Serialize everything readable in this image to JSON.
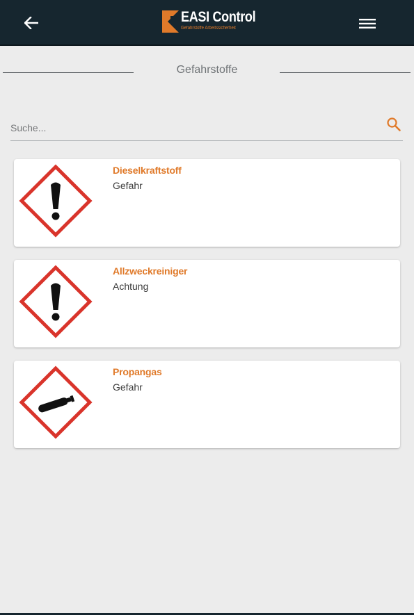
{
  "header": {
    "back_icon": "arrow-left-icon",
    "menu_icon": "hamburger-menu-icon",
    "logo": {
      "title": "EASI Control",
      "tagline": "Gefahrstoffe Arbeitssicherheit"
    }
  },
  "section": {
    "title": "Gefahrstoffe"
  },
  "search": {
    "placeholder": "Suche...",
    "value": "",
    "icon": "search-icon"
  },
  "items": [
    {
      "name": "Dieselkraftstoff",
      "signal_word": "Gefahr",
      "pictogram": "exclamation-mark-icon"
    },
    {
      "name": "Allzweckreiniger",
      "signal_word": "Achtung",
      "pictogram": "exclamation-mark-icon"
    },
    {
      "name": "Propangas",
      "signal_word": "Gefahr",
      "pictogram": "gas-cylinder-icon"
    }
  ],
  "colors": {
    "header_bg": "#16262f",
    "accent": "#e07a2a",
    "ghs_red": "#d9342b",
    "page_bg": "#ececec"
  }
}
